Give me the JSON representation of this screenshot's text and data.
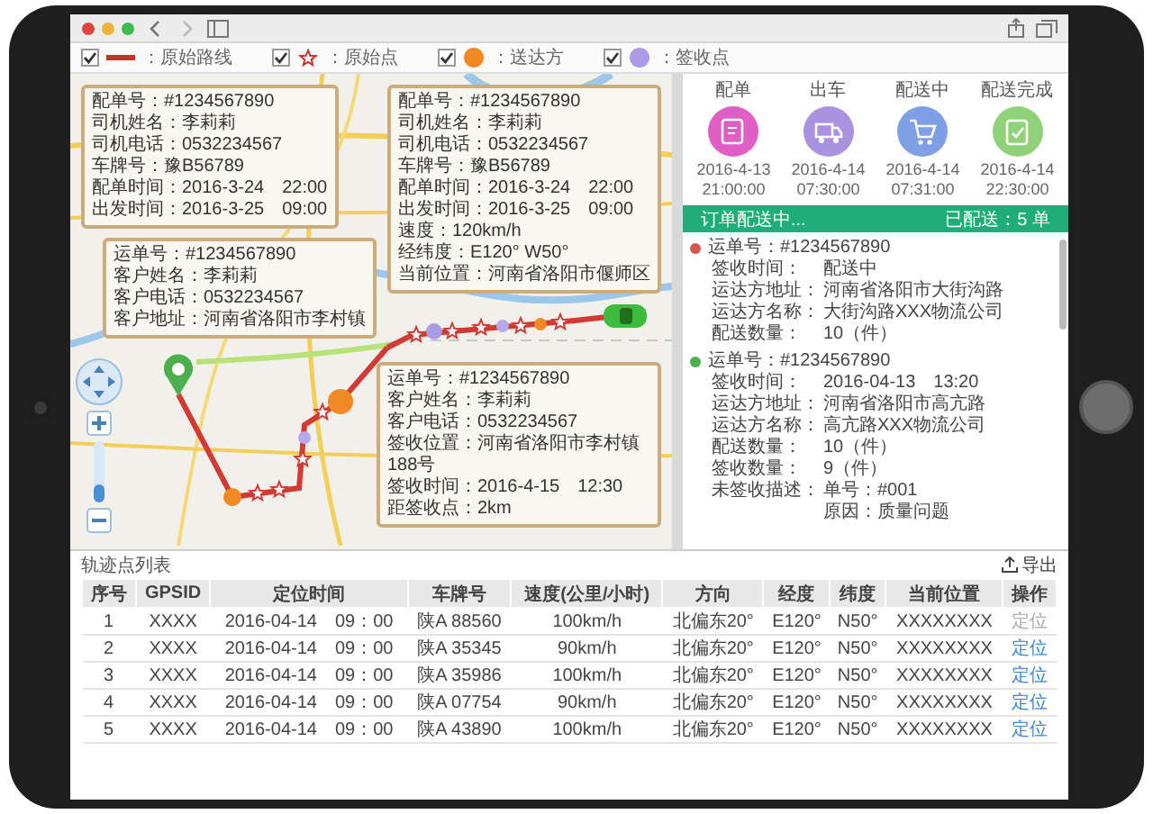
{
  "legend": [
    {
      "kind": "line",
      "label": "：原始路线",
      "checked": true
    },
    {
      "kind": "star",
      "label": "：原始点",
      "checked": true
    },
    {
      "kind": "dot",
      "label": "：送达方",
      "checked": true,
      "color": "#f08a24"
    },
    {
      "kind": "dot",
      "label": "：签收点",
      "checked": true,
      "color": "#a99be6"
    }
  ],
  "map": {
    "zoom": {
      "level": 0.3
    },
    "popups": [
      {
        "lines": [
          "配单号：#1234567890",
          "司机姓名：李莉莉",
          "司机电话：0532234567",
          "车牌号：豫B56789",
          "配单时间：2016-3-24　22:00",
          "出发时间：2016-3-25　09:00"
        ]
      },
      {
        "lines": [
          "配单号：#1234567890",
          "司机姓名：李莉莉",
          "司机电话：0532234567",
          "车牌号：豫B56789",
          "配单时间：2016-3-24　22:00",
          "出发时间：2016-3-25　09:00",
          "速度：120km/h",
          "经纬度：E120° W50°",
          "当前位置：河南省洛阳市偃师区"
        ]
      },
      {
        "lines": [
          "运单号：#1234567890",
          "客户姓名：李莉莉",
          "客户电话：0532234567",
          "客户地址：河南省洛阳市李村镇"
        ]
      },
      {
        "lines": [
          "运单号：#1234567890",
          "客户姓名：李莉莉",
          "客户电话：0532234567",
          "签收位置：河南省洛阳市李村镇188号",
          "签收时间：2016-4-15　12:30",
          "距签收点：2km"
        ]
      }
    ]
  },
  "steps": [
    {
      "label": "配单",
      "date": "2016-4-13",
      "time": "21:00:00",
      "color": "#e05fc4"
    },
    {
      "label": "出车",
      "date": "2016-4-14",
      "time": "07:30:00",
      "color": "#a992e0"
    },
    {
      "label": "配送中",
      "date": "2016-4-14",
      "time": "07:31:00",
      "color": "#7f9fe6"
    },
    {
      "label": "配送完成",
      "date": "2016-4-14",
      "time": "22:30:00",
      "color": "#8fd27a"
    }
  ],
  "status_bar": {
    "left": "订单配送中...",
    "right": "已配送：5 单"
  },
  "orders": [
    {
      "number": "运单号：#1234567890",
      "color": "#d9534f",
      "fields": [
        {
          "label": "签收时间：",
          "value": "配送中"
        },
        {
          "label": "运达方地址：",
          "value": "河南省洛阳市大街沟路"
        },
        {
          "label": "运达方名称：",
          "value": "大街沟路XXX物流公司"
        },
        {
          "label": "配送数量：",
          "value": "10（件）"
        }
      ]
    },
    {
      "number": "运单号：#1234567890",
      "color": "#4caf50",
      "fields": [
        {
          "label": "签收时间：",
          "value": "2016-04-13　13:20"
        },
        {
          "label": "运达方地址：",
          "value": "河南省洛阳市高亢路"
        },
        {
          "label": "运达方名称：",
          "value": "高亢路XXX物流公司"
        },
        {
          "label": "配送数量：",
          "value": "10（件）"
        },
        {
          "label": "签收数量：",
          "value": "9（件）"
        },
        {
          "label": "未签收描述：",
          "value": "单号：#001",
          "value_2": "原因：质量问题"
        }
      ]
    }
  ],
  "table": {
    "title": "轨迹点列表",
    "export": "导出",
    "columns": [
      "序号",
      "GPSID",
      "定位时间",
      "车牌号",
      "速度(公里/小时)",
      "方向",
      "经度",
      "纬度",
      "当前位置",
      "操作"
    ],
    "rows": [
      {
        "cells": [
          "1",
          "XXXX",
          "2016-04-14　09：00",
          "陕A 88560",
          "100km/h",
          "北偏东20°",
          "E120°",
          "N50°",
          "XXXXXXXX"
        ],
        "action": "定位",
        "disabled": true
      },
      {
        "cells": [
          "2",
          "XXXX",
          "2016-04-14　09：00",
          "陕A 35345",
          "90km/h",
          "北偏东20°",
          "E120°",
          "N50°",
          "XXXXXXXX"
        ],
        "action": "定位",
        "disabled": false
      },
      {
        "cells": [
          "3",
          "XXXX",
          "2016-04-14　09：00",
          "陕A 35986",
          "100km/h",
          "北偏东20°",
          "E120°",
          "N50°",
          "XXXXXXXX"
        ],
        "action": "定位",
        "disabled": false
      },
      {
        "cells": [
          "4",
          "XXXX",
          "2016-04-14　09：00",
          "陕A 07754",
          "90km/h",
          "北偏东20°",
          "E120°",
          "N50°",
          "XXXXXXXX"
        ],
        "action": "定位",
        "disabled": false
      },
      {
        "cells": [
          "5",
          "XXXX",
          "2016-04-14　09：00",
          "陕A 43890",
          "100km/h",
          "北偏东20°",
          "E120°",
          "N50°",
          "XXXXXXXX"
        ],
        "action": "定位",
        "disabled": false
      }
    ]
  }
}
